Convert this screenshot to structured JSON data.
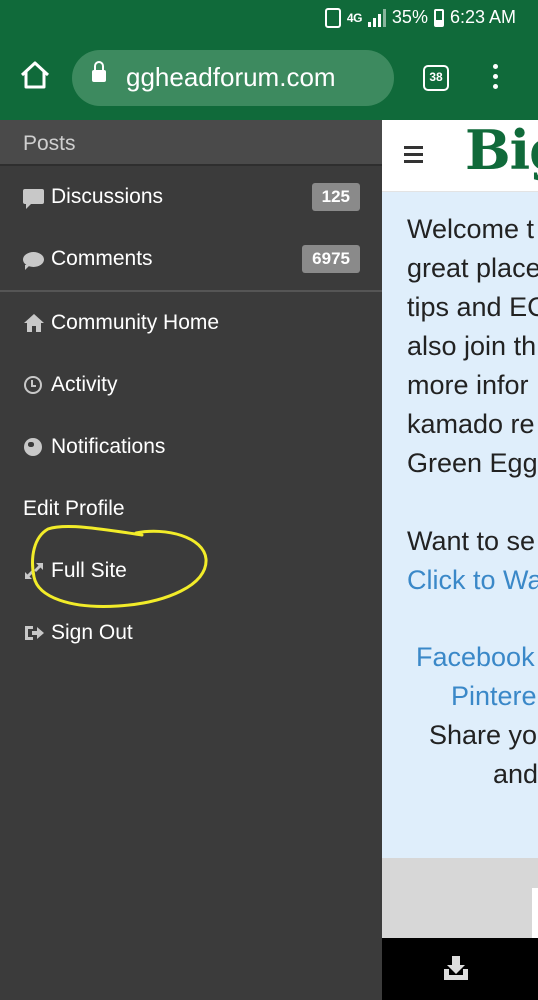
{
  "status_bar": {
    "network": "4G",
    "battery": "35%",
    "time": "6:23 AM"
  },
  "browser": {
    "url": "ggheadforum.com",
    "tab_count": "38"
  },
  "drawer": {
    "section_title": "Posts",
    "items": [
      {
        "label": "Discussions",
        "count": "125",
        "icon": "discussions-icon"
      },
      {
        "label": "Comments",
        "count": "6975",
        "icon": "comments-icon"
      },
      {
        "label": "Community Home",
        "icon": "home-icon"
      },
      {
        "label": "Activity",
        "icon": "clock-icon"
      },
      {
        "label": "Notifications",
        "icon": "globe-icon"
      },
      {
        "label": "Edit Profile"
      },
      {
        "label": "Full Site",
        "icon": "expand-arrows-icon"
      },
      {
        "label": "Sign Out",
        "icon": "sign-out-icon"
      }
    ]
  },
  "page": {
    "brand": "Big",
    "body_lines": [
      "Welcome t",
      "great place",
      "tips and EC",
      "also join th",
      "more infor",
      "kamado re",
      "Green Egg"
    ],
    "want_line": "Want to se",
    "click_link": "Click to Wa",
    "facebook_link": "Facebook",
    "pinterest_link": "Pintere",
    "share_line": "Share yo",
    "and_line": "and"
  },
  "colors": {
    "browser_green": "#106a3a",
    "drawer_bg": "#3b3b3b",
    "highlight": "#f2ec29",
    "link_blue": "#3a88c8"
  }
}
